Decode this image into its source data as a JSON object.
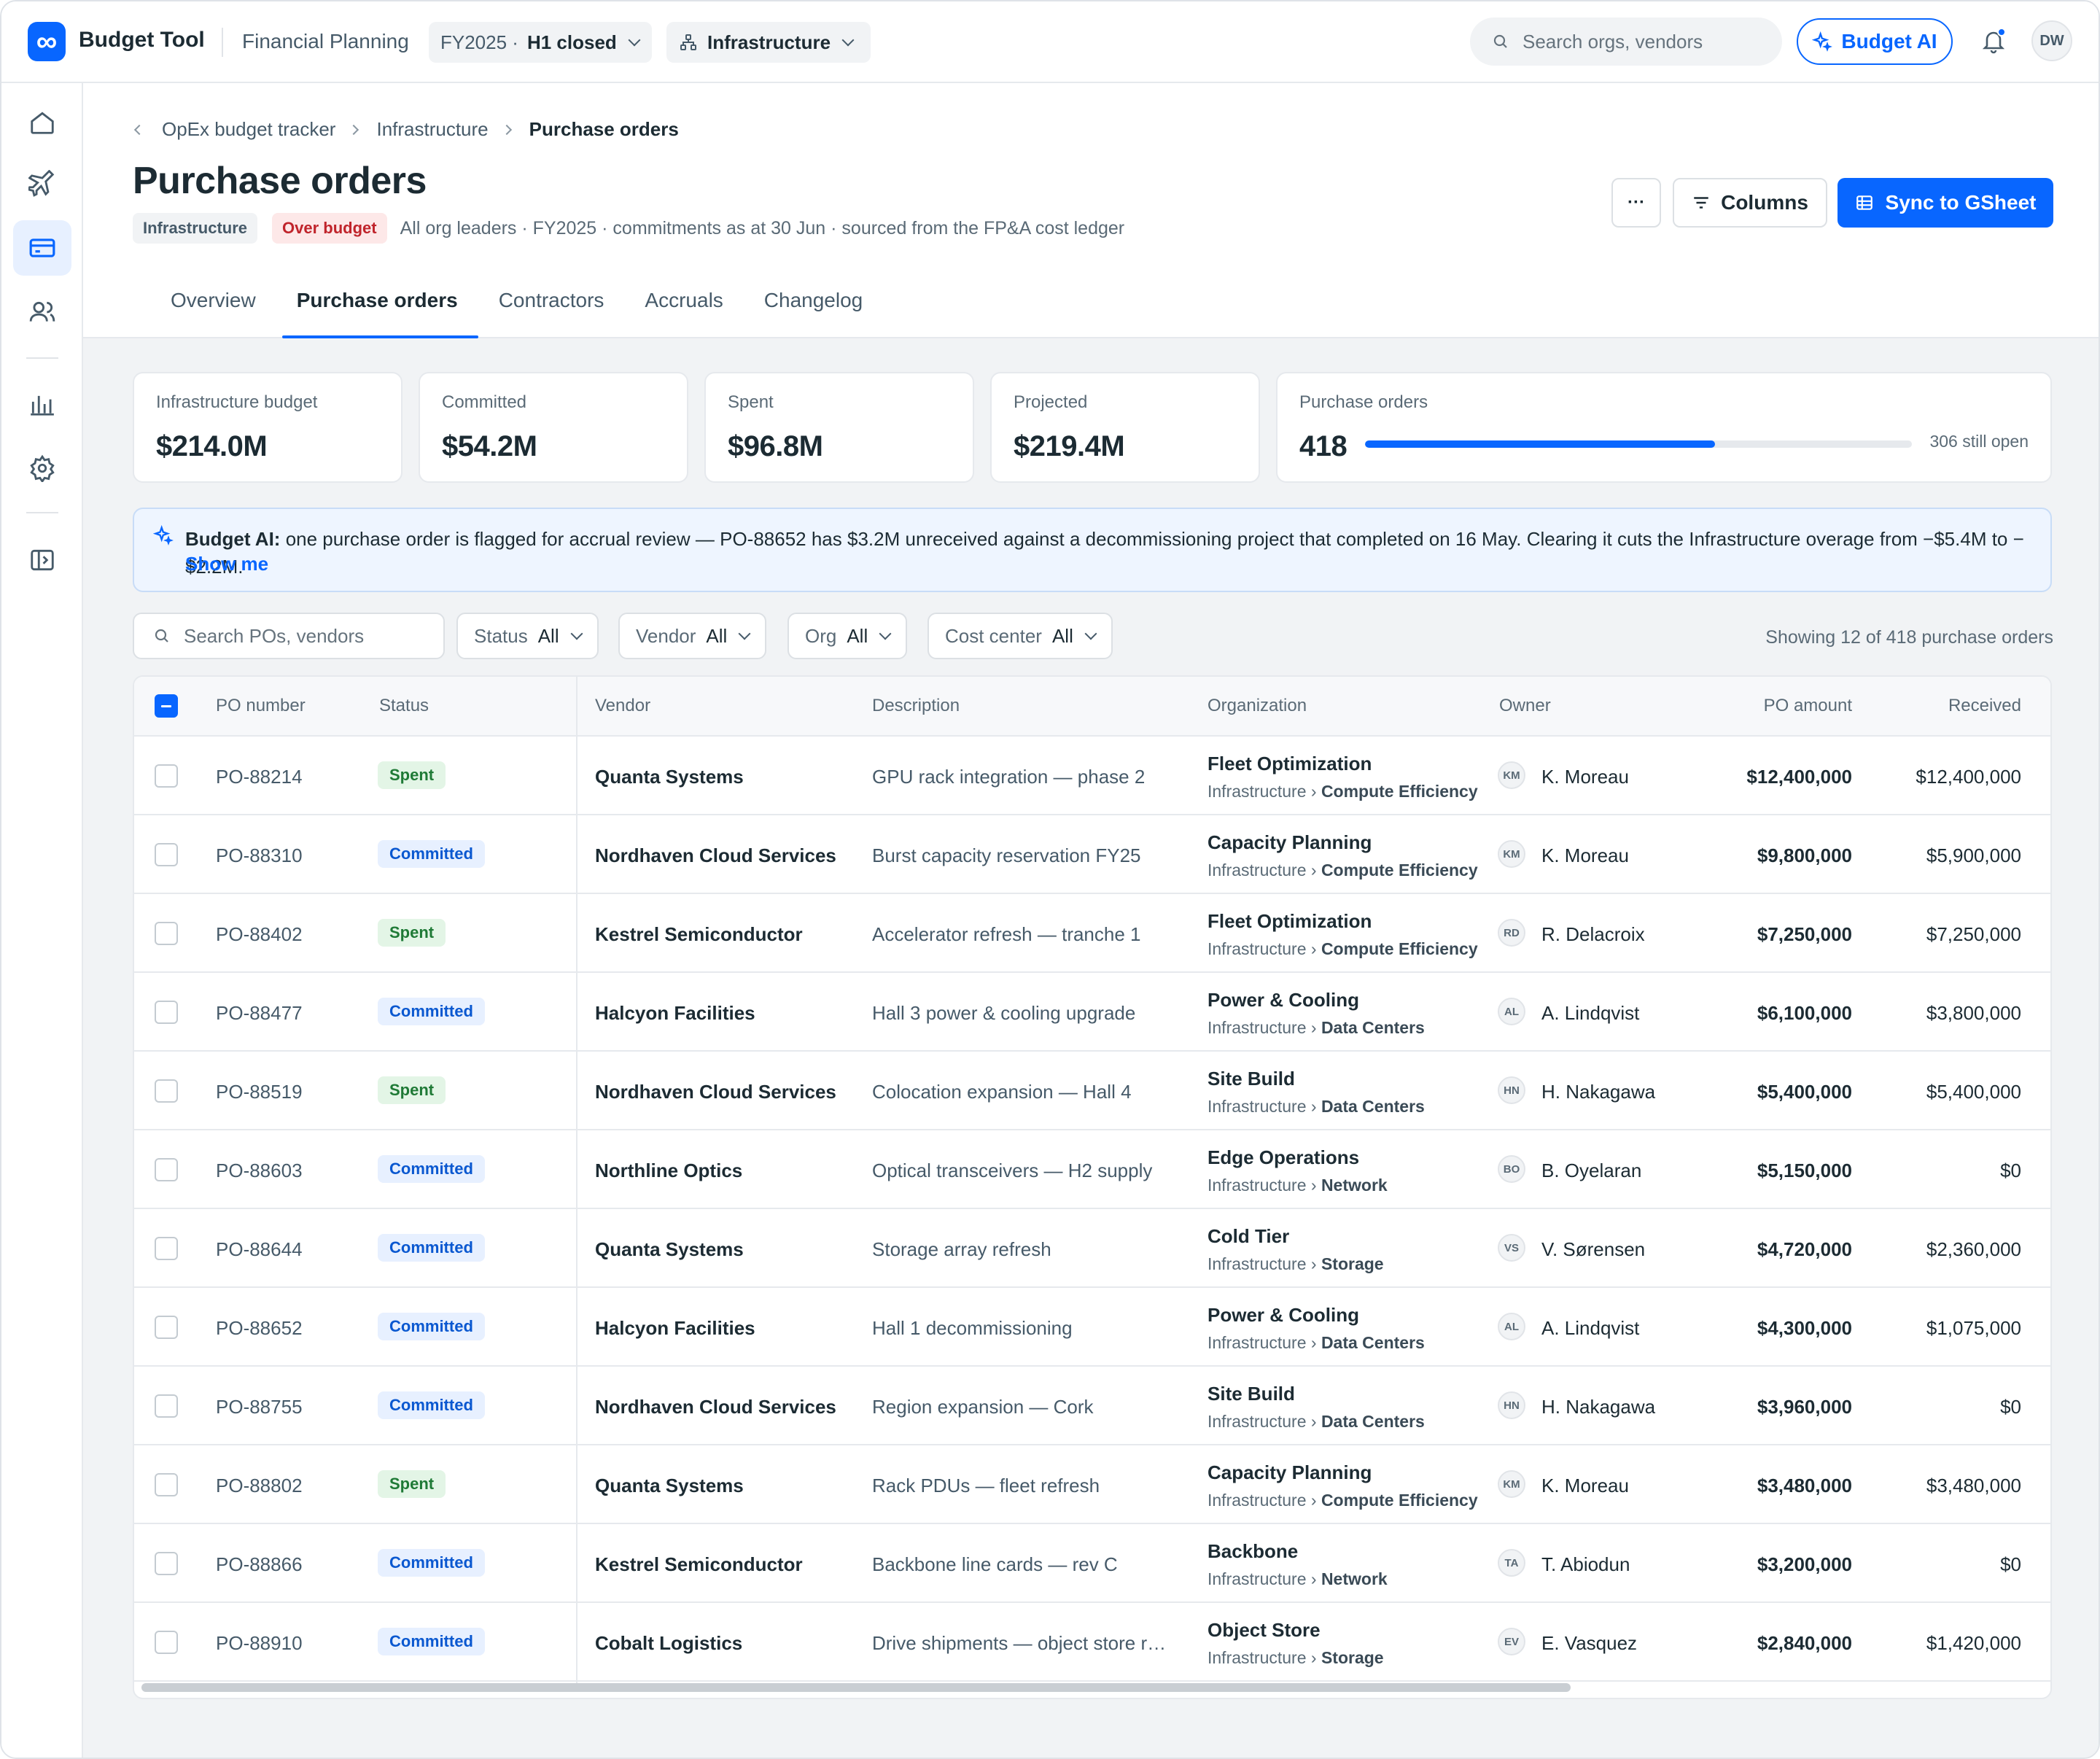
{
  "topbar": {
    "app_name": "Budget Tool",
    "section": "Financial Planning",
    "fy_prefix": "FY2025 ·",
    "fy_value": "H1 closed",
    "org_value": "Infrastructure",
    "search_placeholder": "Search orgs, vendors",
    "ai_button": "Budget AI",
    "user_initials": "DW"
  },
  "breadcrumb": [
    "OpEx budget tracker",
    "Infrastructure",
    "Purchase orders"
  ],
  "page": {
    "title": "Purchase orders",
    "badge_org": "Infrastructure",
    "badge_status": "Over budget",
    "subline": "All org leaders · FY2025 · commitments as at 30 Jun · sourced from the FP&A cost ledger",
    "more_label": "···",
    "columns_label": "Columns",
    "sync_label": "Sync to GSheet"
  },
  "tabs": [
    "Overview",
    "Purchase orders",
    "Contractors",
    "Accruals",
    "Changelog"
  ],
  "active_tab": "Purchase orders",
  "metrics": [
    {
      "label": "Infrastructure budget",
      "value": "$214.0M"
    },
    {
      "label": "Committed",
      "value": "$54.2M"
    },
    {
      "label": "Spent",
      "value": "$96.8M"
    },
    {
      "label": "Projected",
      "value": "$219.4M"
    }
  ],
  "po_card": {
    "label": "Purchase orders",
    "value": "418",
    "still_open": "306 still open",
    "progress_fraction": 0.64
  },
  "ai_banner": {
    "prefix": "Budget AI:",
    "text": " one purchase order is flagged for accrual review — PO-88652 has $3.2M unreceived against a decommissioning project that completed on 16 May. Clearing it cuts the Infrastructure overage from −$5.4M to −$2.2M.",
    "link": "Show me"
  },
  "filters": {
    "search_placeholder": "Search POs, vendors",
    "chips": [
      {
        "label": "Status",
        "value": "All"
      },
      {
        "label": "Vendor",
        "value": "All"
      },
      {
        "label": "Org",
        "value": "All"
      },
      {
        "label": "Cost center",
        "value": "All"
      }
    ],
    "showing": "Showing 12 of 418 purchase orders"
  },
  "table": {
    "headers": [
      "PO number",
      "Status",
      "Vendor",
      "Description",
      "Organization",
      "Owner",
      "PO amount",
      "Received"
    ],
    "rows": [
      {
        "po": "PO-88214",
        "status": "Spent",
        "vendor": "Quanta Systems",
        "desc": "GPU rack integration — phase 2",
        "org": "Fleet Optimization",
        "org_parent": "Infrastructure ›",
        "org_child": "Compute Efficiency",
        "initials": "KM",
        "owner": "K. Moreau",
        "amount": "$12,400,000",
        "received": "$12,400,000"
      },
      {
        "po": "PO-88310",
        "status": "Committed",
        "vendor": "Nordhaven Cloud Services",
        "desc": "Burst capacity reservation FY25",
        "org": "Capacity Planning",
        "org_parent": "Infrastructure ›",
        "org_child": "Compute Efficiency",
        "initials": "KM",
        "owner": "K. Moreau",
        "amount": "$9,800,000",
        "received": "$5,900,000"
      },
      {
        "po": "PO-88402",
        "status": "Spent",
        "vendor": "Kestrel Semiconductor",
        "desc": "Accelerator refresh — tranche 1",
        "org": "Fleet Optimization",
        "org_parent": "Infrastructure ›",
        "org_child": "Compute Efficiency",
        "initials": "RD",
        "owner": "R. Delacroix",
        "amount": "$7,250,000",
        "received": "$7,250,000"
      },
      {
        "po": "PO-88477",
        "status": "Committed",
        "vendor": "Halcyon Facilities",
        "desc": "Hall 3 power & cooling upgrade",
        "org": "Power & Cooling",
        "org_parent": "Infrastructure ›",
        "org_child": "Data Centers",
        "initials": "AL",
        "owner": "A. Lindqvist",
        "amount": "$6,100,000",
        "received": "$3,800,000"
      },
      {
        "po": "PO-88519",
        "status": "Spent",
        "vendor": "Nordhaven Cloud Services",
        "desc": "Colocation expansion — Hall 4",
        "org": "Site Build",
        "org_parent": "Infrastructure ›",
        "org_child": "Data Centers",
        "initials": "HN",
        "owner": "H. Nakagawa",
        "amount": "$5,400,000",
        "received": "$5,400,000"
      },
      {
        "po": "PO-88603",
        "status": "Committed",
        "vendor": "Northline Optics",
        "desc": "Optical transceivers — H2 supply",
        "org": "Edge Operations",
        "org_parent": "Infrastructure ›",
        "org_child": "Network",
        "initials": "BO",
        "owner": "B. Oyelaran",
        "amount": "$5,150,000",
        "received": "$0"
      },
      {
        "po": "PO-88644",
        "status": "Committed",
        "vendor": "Quanta Systems",
        "desc": "Storage array refresh",
        "org": "Cold Tier",
        "org_parent": "Infrastructure ›",
        "org_child": "Storage",
        "initials": "VS",
        "owner": "V. Sørensen",
        "amount": "$4,720,000",
        "received": "$2,360,000"
      },
      {
        "po": "PO-88652",
        "status": "Committed",
        "vendor": "Halcyon Facilities",
        "desc": "Hall 1 decommissioning",
        "org": "Power & Cooling",
        "org_parent": "Infrastructure ›",
        "org_child": "Data Centers",
        "initials": "AL",
        "owner": "A. Lindqvist",
        "amount": "$4,300,000",
        "received": "$1,075,000"
      },
      {
        "po": "PO-88755",
        "status": "Committed",
        "vendor": "Nordhaven Cloud Services",
        "desc": "Region expansion — Cork",
        "org": "Site Build",
        "org_parent": "Infrastructure ›",
        "org_child": "Data Centers",
        "initials": "HN",
        "owner": "H. Nakagawa",
        "amount": "$3,960,000",
        "received": "$0"
      },
      {
        "po": "PO-88802",
        "status": "Spent",
        "vendor": "Quanta Systems",
        "desc": "Rack PDUs — fleet refresh",
        "org": "Capacity Planning",
        "org_parent": "Infrastructure ›",
        "org_child": "Compute Efficiency",
        "initials": "KM",
        "owner": "K. Moreau",
        "amount": "$3,480,000",
        "received": "$3,480,000"
      },
      {
        "po": "PO-88866",
        "status": "Committed",
        "vendor": "Kestrel Semiconductor",
        "desc": "Backbone line cards — rev C",
        "org": "Backbone",
        "org_parent": "Infrastructure ›",
        "org_child": "Network",
        "initials": "TA",
        "owner": "T. Abiodun",
        "amount": "$3,200,000",
        "received": "$0"
      },
      {
        "po": "PO-88910",
        "status": "Committed",
        "vendor": "Cobalt Logistics",
        "desc": "Drive shipments — object store r…",
        "org": "Object Store",
        "org_parent": "Infrastructure ›",
        "org_child": "Storage",
        "initials": "EV",
        "owner": "E. Vasquez",
        "amount": "$2,840,000",
        "received": "$1,420,000"
      }
    ]
  },
  "colors": {
    "accent": "#0866ff",
    "spent_bg": "#e3f5e6",
    "committed_bg": "#e7f0ff",
    "over_budget": "#c0242b"
  }
}
